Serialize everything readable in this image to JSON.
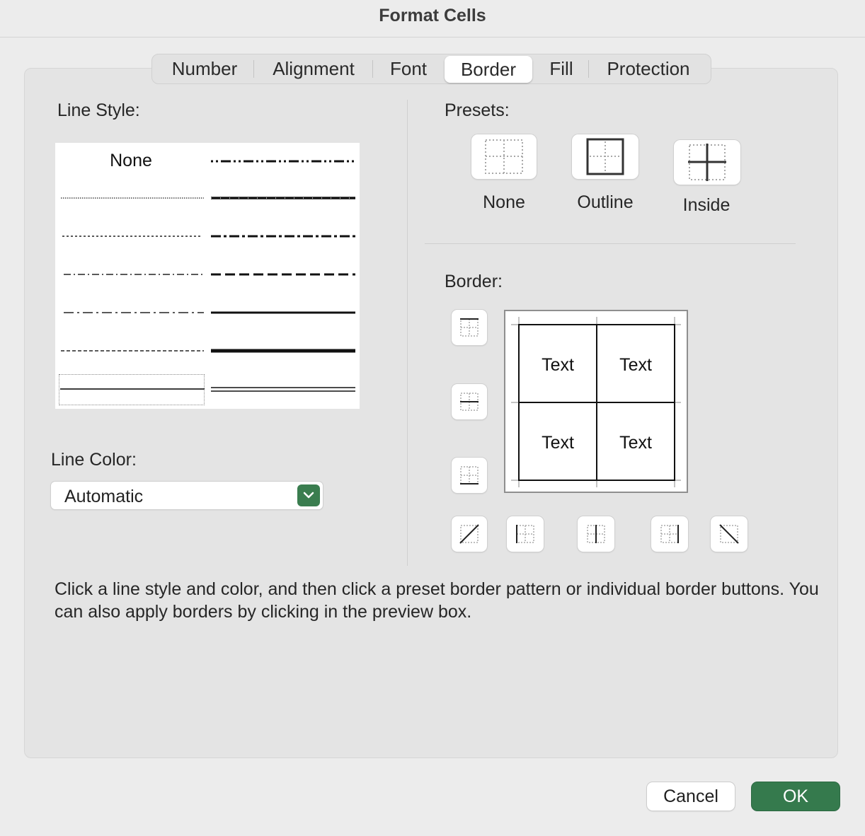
{
  "window": {
    "title": "Format Cells"
  },
  "tabs": [
    {
      "label": "Number"
    },
    {
      "label": "Alignment"
    },
    {
      "label": "Font"
    },
    {
      "label": "Border"
    },
    {
      "label": "Fill"
    },
    {
      "label": "Protection"
    }
  ],
  "active_tab": "Border",
  "line_style": {
    "label": "Line Style:",
    "none_label": "None",
    "selected": "thin"
  },
  "line_color": {
    "label": "Line Color:",
    "value": "Automatic"
  },
  "presets": {
    "label": "Presets:",
    "items": [
      {
        "label": "None",
        "icon": "preset-none-icon"
      },
      {
        "label": "Outline",
        "icon": "preset-outline-icon"
      },
      {
        "label": "Inside",
        "icon": "preset-inside-icon"
      }
    ]
  },
  "border": {
    "label": "Border:",
    "preview_cells": [
      "Text",
      "Text",
      "Text",
      "Text"
    ]
  },
  "description": "Click a line style and color, and then click a preset border pattern or individual border buttons. You can also apply borders by clicking in the preview box.",
  "buttons": {
    "cancel": "Cancel",
    "ok": "OK"
  },
  "colors": {
    "accent_green": "#357a4d",
    "panel": "#e4e4e4",
    "background": "#ececec"
  }
}
